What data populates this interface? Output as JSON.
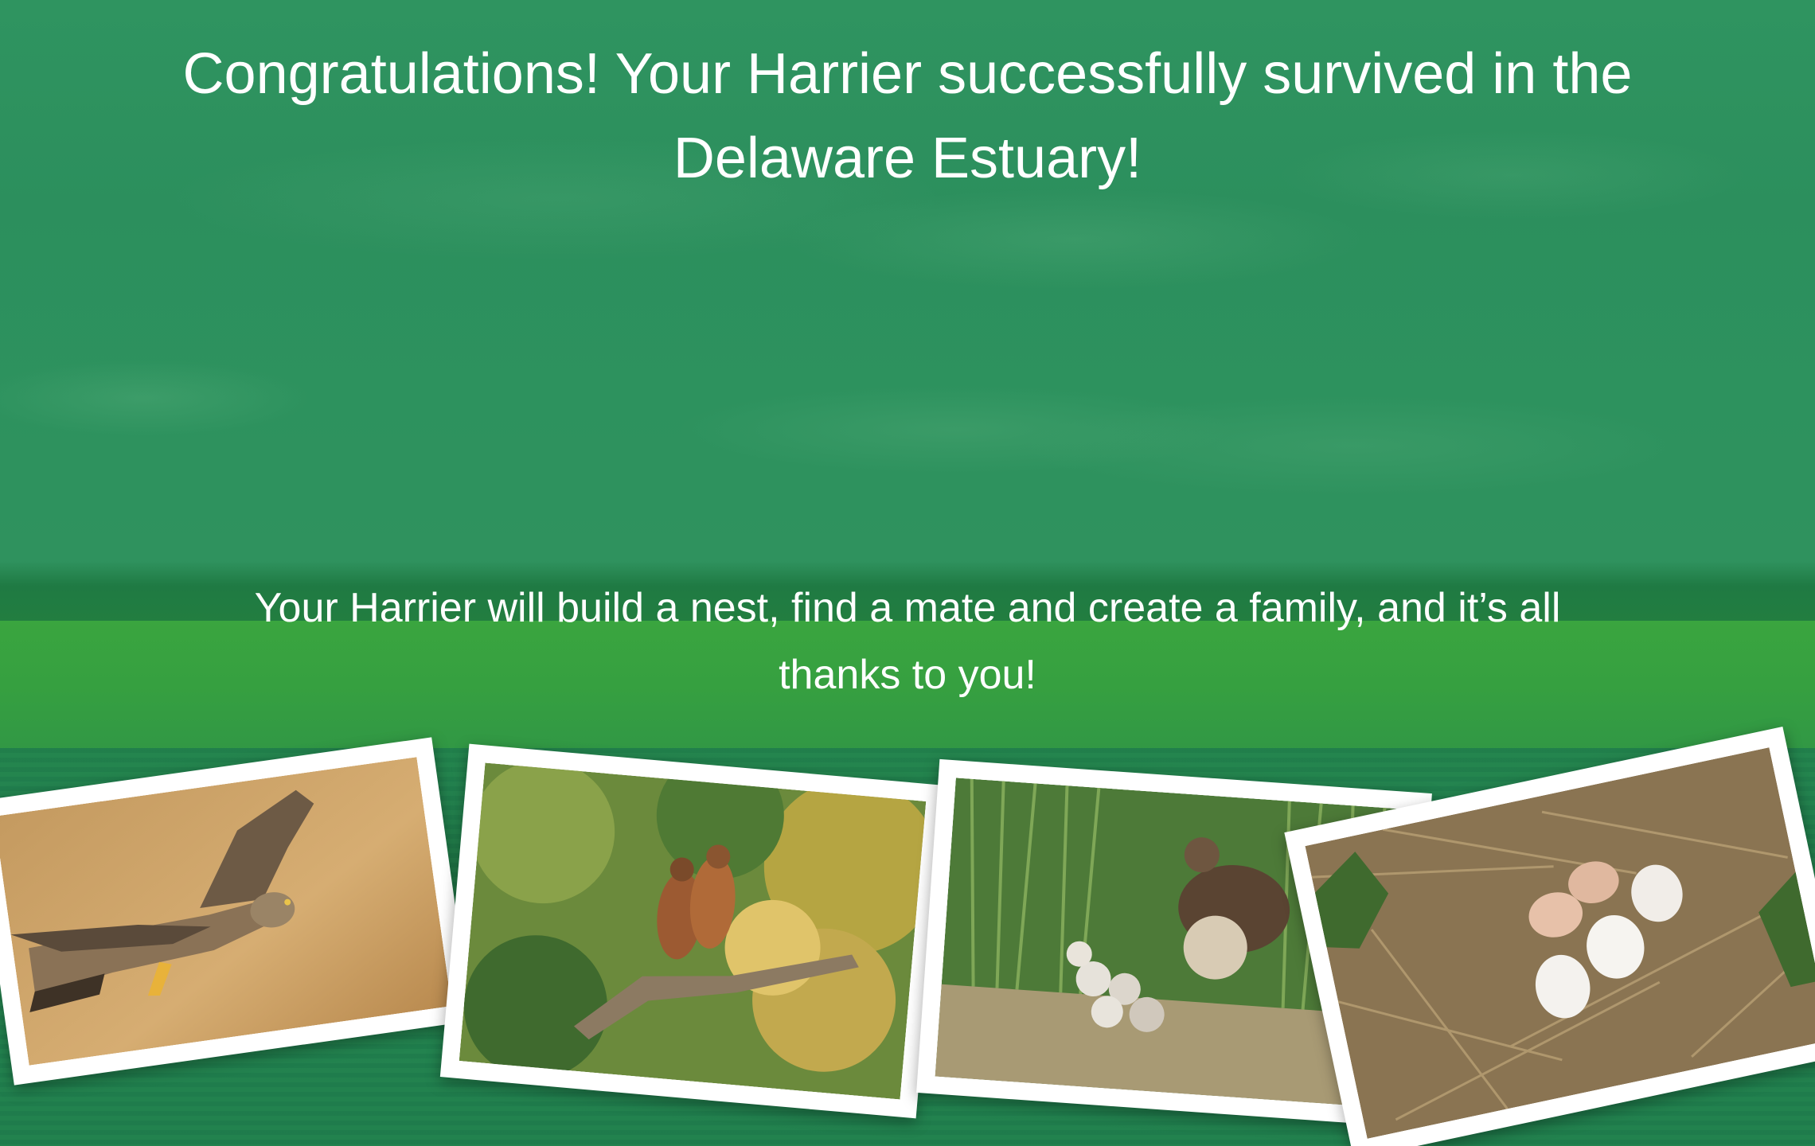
{
  "headline": "Congratulations! Your Harrier successfully survived in the Delaware Estuary!",
  "subline": "Your Harrier will build a nest, find a mate and create a family, and it’s all thanks to you!",
  "photos": [
    {
      "subject": "harrier-in-flight"
    },
    {
      "subject": "hawk-pair-perched"
    },
    {
      "subject": "harrier-with-chicks"
    },
    {
      "subject": "nest-with-eggs-and-chicks"
    }
  ]
}
